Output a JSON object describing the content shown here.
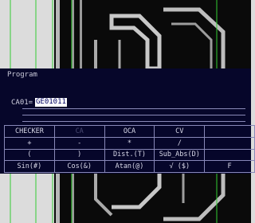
{
  "program": {
    "title": "Program",
    "line_label": "CA01=",
    "line_value": "GE01011"
  },
  "function_keys": [
    [
      "CHECKER",
      "CA",
      "OCA",
      "CV",
      ""
    ],
    [
      "+",
      "-",
      "*",
      "/",
      ""
    ],
    [
      "(",
      ")",
      "Dist.(T)",
      "Sub_Abs(D)",
      ""
    ],
    [
      "Sin(#)",
      "Cos(&)",
      "Atan(@)",
      "√ ($)",
      "F"
    ]
  ]
}
